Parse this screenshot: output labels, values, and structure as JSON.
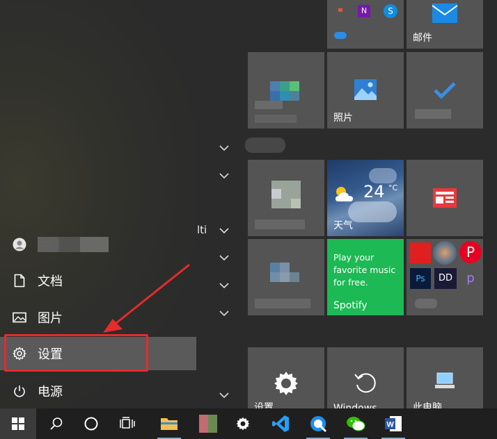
{
  "left_menu": {
    "items": [
      {
        "label": "文档",
        "icon": "document-icon"
      },
      {
        "label": "图片",
        "icon": "picture-icon"
      },
      {
        "label": "设置",
        "icon": "gear-icon"
      },
      {
        "label": "电源",
        "icon": "power-icon"
      }
    ]
  },
  "middle": {
    "partial_text": "lti"
  },
  "tiles": {
    "mail": {
      "label": "邮件"
    },
    "photos": {
      "label": "照片"
    },
    "weather": {
      "label": "天气",
      "temperature": "24",
      "unit": "°C"
    },
    "spotify": {
      "promo": "Play your favorite music for free.",
      "label": "Spotify"
    },
    "settings_tile": {
      "label": "设置"
    },
    "windows_backup": {
      "label": "Windows ..."
    },
    "pc": {
      "label": "此电脑"
    }
  },
  "taskbar": {
    "items": [
      "windows-start-icon",
      "search-icon",
      "cortana-icon",
      "task-view-icon",
      "file-explorer-icon",
      "app-icon",
      "settings-icon",
      "vscode-icon",
      "qq-icon",
      "wechat-icon",
      "word-icon"
    ]
  },
  "colors": {
    "accent_red": "#e52b2b",
    "spotify_green": "#1db954",
    "tile_gray": "#545454",
    "taskbar": "#1f1f1f"
  }
}
